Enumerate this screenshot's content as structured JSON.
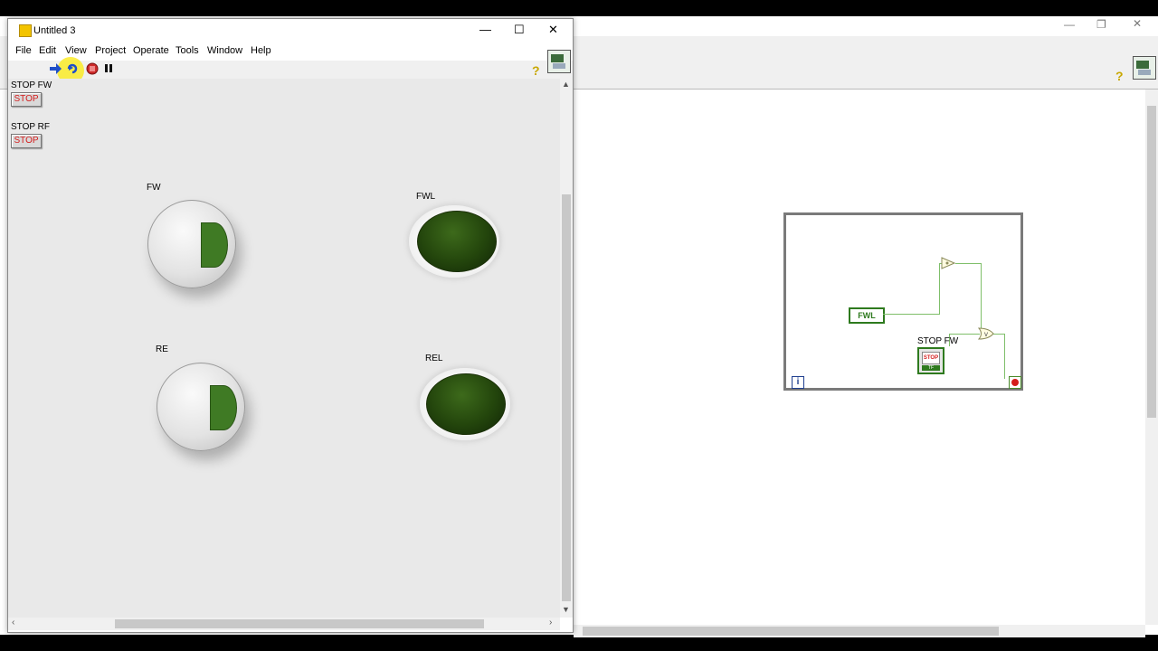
{
  "front_panel": {
    "title": "Untitled 3",
    "menu": [
      "File",
      "Edit",
      "View",
      "Project",
      "Operate",
      "Tools",
      "Window",
      "Help"
    ],
    "controls": {
      "stop_fw": {
        "label": "STOP FW",
        "button_text": "STOP"
      },
      "stop_rf": {
        "label": "STOP RF",
        "button_text": "STOP"
      },
      "fw": {
        "label": "FW"
      },
      "re": {
        "label": "RE"
      },
      "fwl": {
        "label": "FWL"
      },
      "rel": {
        "label": "REL"
      }
    }
  },
  "block_diagram": {
    "nodes": {
      "fwl_local": "FWL",
      "stop_fw_terminal": {
        "label": "STOP FW",
        "icon_text": "STOP",
        "sub_text": "TF"
      },
      "iteration": "i"
    }
  },
  "colors": {
    "wire_boolean": "#7fbf6a",
    "led_off": "#23450c",
    "stop_text": "#d41c1c",
    "loop_border": "#7a7a7a"
  }
}
